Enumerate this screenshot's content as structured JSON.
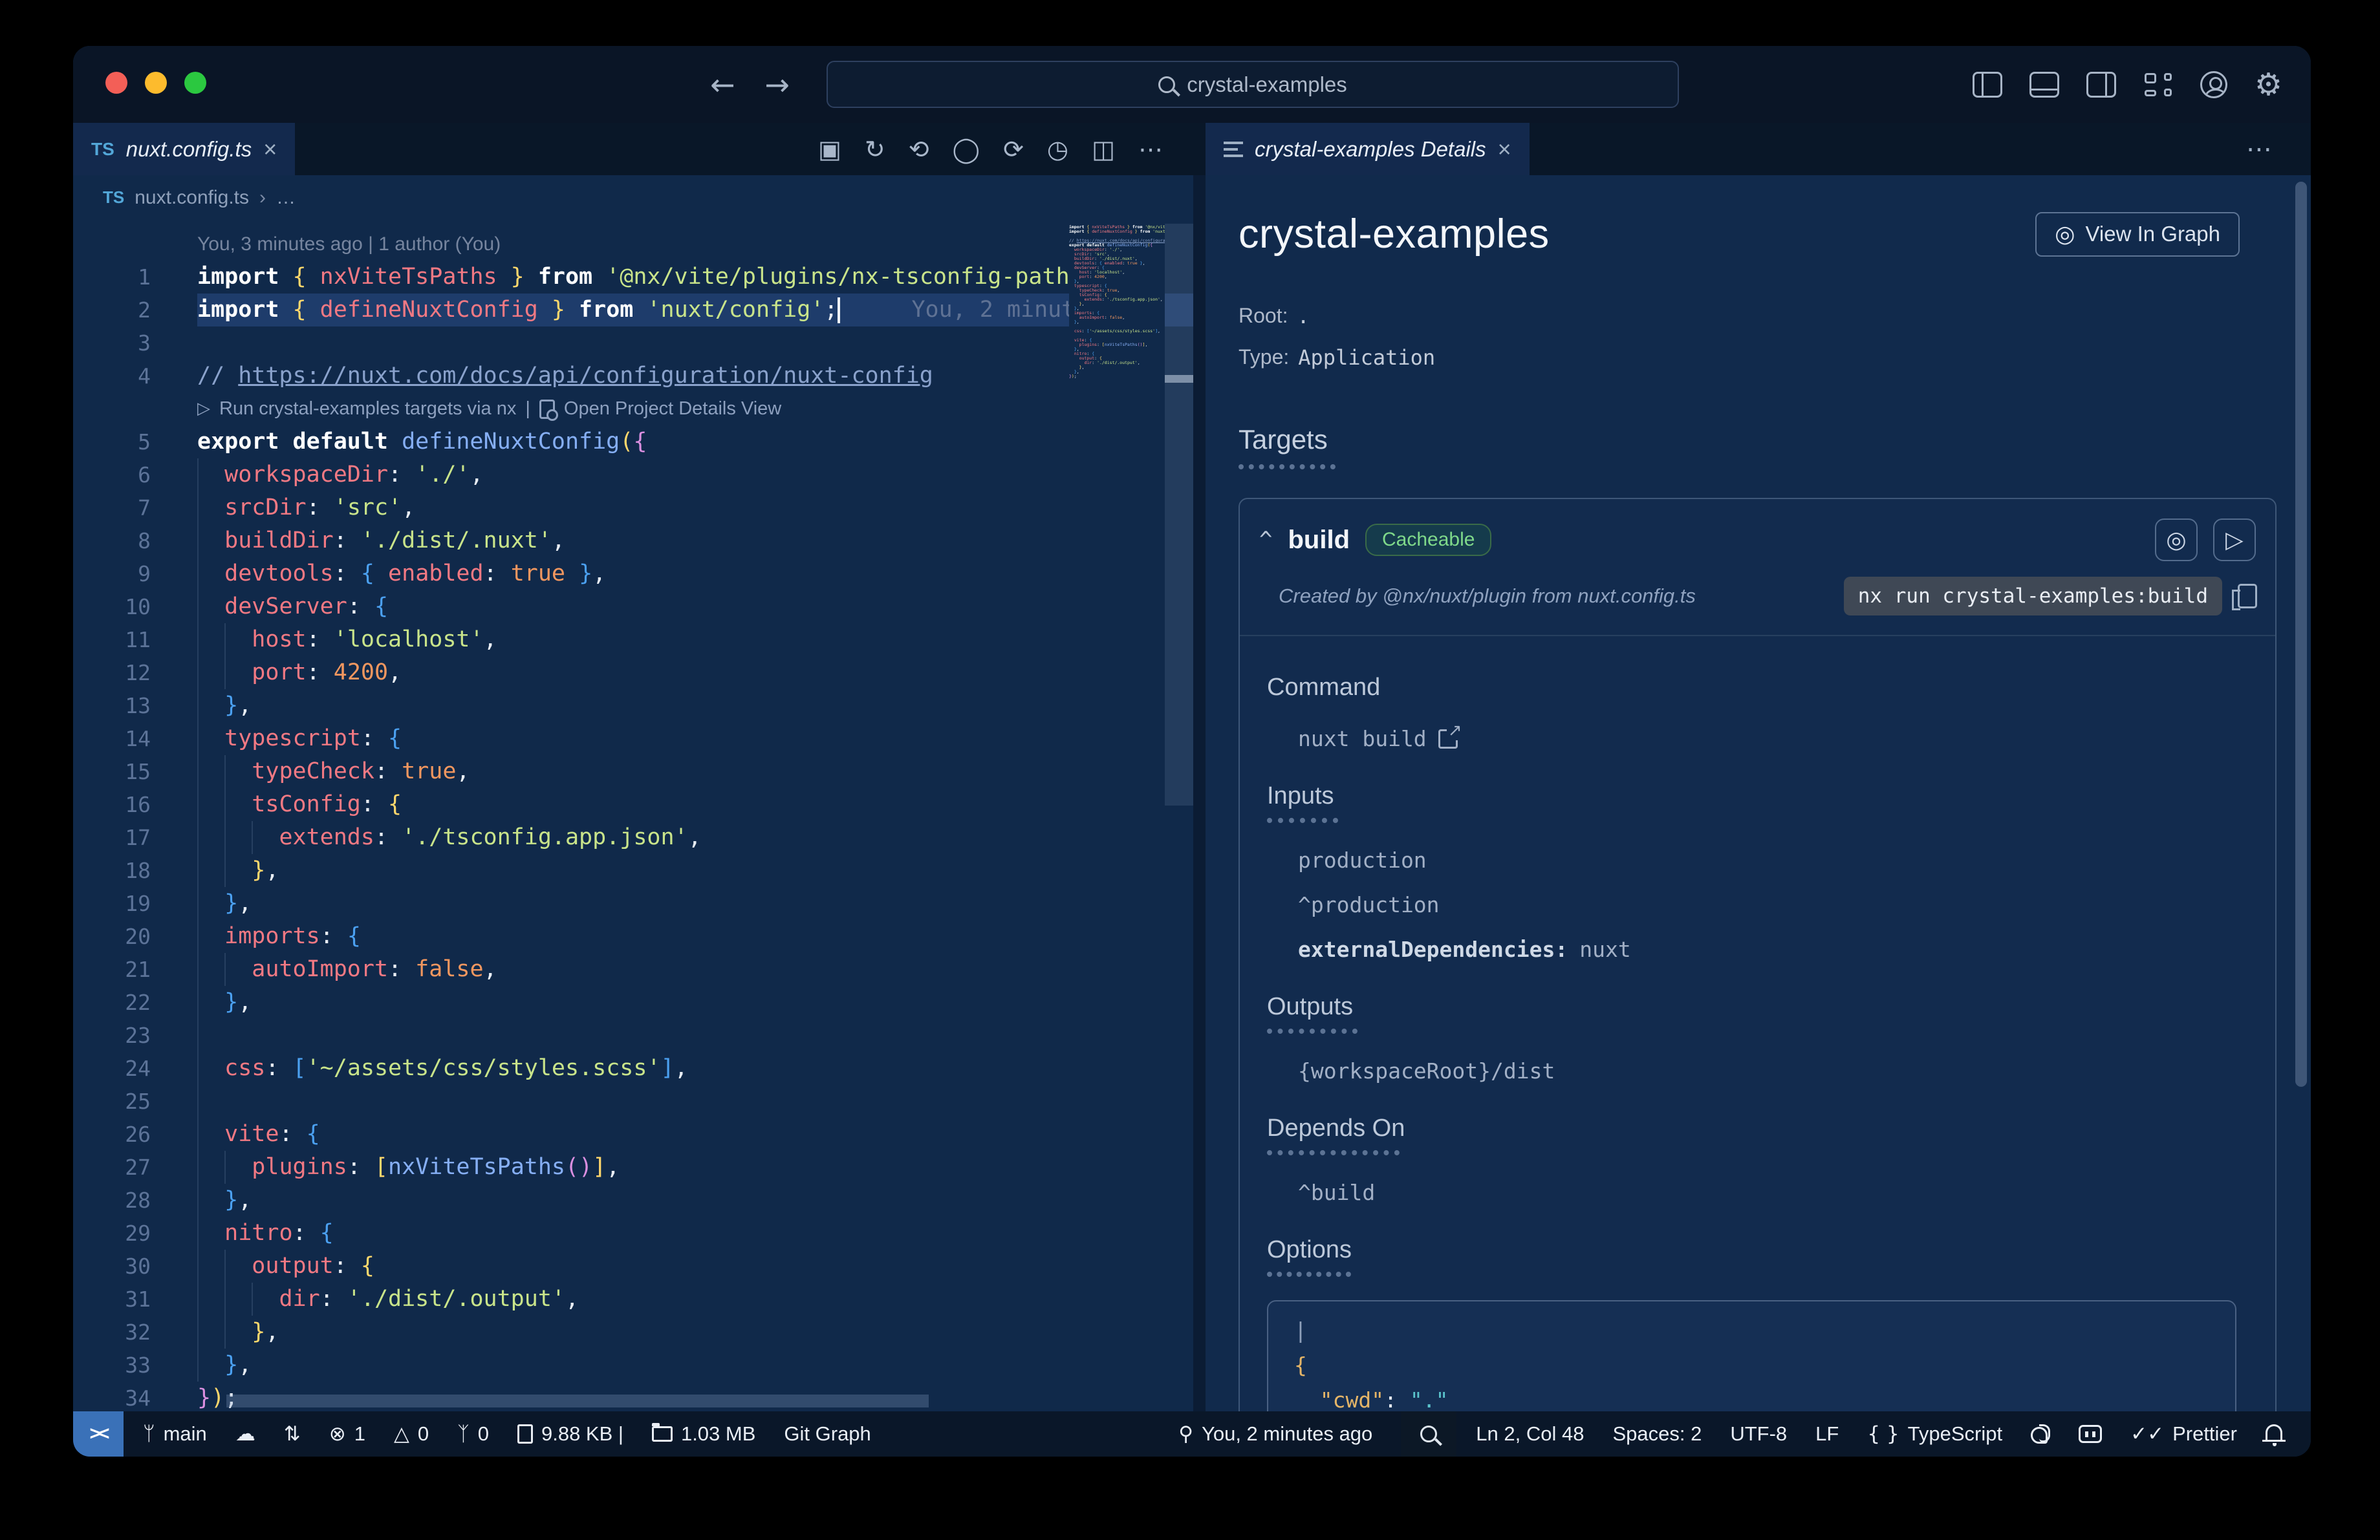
{
  "window": {
    "search_value": "crystal-examples",
    "titlebar_icons": [
      "toggle-panel-left",
      "toggle-panel-bottom",
      "toggle-panel-right",
      "customize-layout",
      "account",
      "settings-gear"
    ]
  },
  "editor": {
    "tab": {
      "file_type": "TS",
      "label": "nuxt.config.ts"
    },
    "toolbar_icons": [
      "open-changes",
      "refresh",
      "prev-change",
      "current-change",
      "next-change",
      "timeline",
      "split-editor",
      "more-actions"
    ],
    "breadcrumb": {
      "file_type": "TS",
      "file": "nuxt.config.ts",
      "separator": "›",
      "symbol": "…"
    },
    "blame_line": "You, 3 minutes ago | 1 author (You)",
    "inline_blame": "You, 2 minut",
    "codelens": {
      "run_label": "Run crystal-examples targets via nx",
      "separator": "|",
      "details_label": "Open Project Details View"
    },
    "lines": [
      {
        "t": "meta"
      },
      {
        "t": "c",
        "n": "1",
        "tok": [
          [
            "k",
            "import "
          ],
          [
            "by",
            "{ "
          ],
          [
            "prop",
            "nxViteTsPaths"
          ],
          [
            "by",
            " }"
          ],
          [
            "k",
            " from "
          ],
          [
            "str",
            "'@nx/vite/plugins/nx-tsconfig-paths"
          ]
        ]
      },
      {
        "t": "c",
        "n": "2",
        "cur": true,
        "tok": [
          [
            "k",
            "import "
          ],
          [
            "by",
            "{ "
          ],
          [
            "prop",
            "defineNuxtConfig"
          ],
          [
            "by",
            " }"
          ],
          [
            "k",
            " from "
          ],
          [
            "str",
            "'nuxt/config'"
          ],
          [
            "p",
            ";"
          ]
        ]
      },
      {
        "t": "c",
        "n": "3",
        "tok": []
      },
      {
        "t": "c",
        "n": "4",
        "tok": [
          [
            "com",
            "// "
          ],
          [
            "link",
            "https://nuxt.com/docs/api/configuration/nuxt-config"
          ]
        ]
      },
      {
        "t": "lens"
      },
      {
        "t": "c",
        "n": "5",
        "tok": [
          [
            "k",
            "export default "
          ],
          [
            "fn",
            "defineNuxtConfig"
          ],
          [
            "by",
            "("
          ],
          [
            "bm",
            "{"
          ]
        ]
      },
      {
        "t": "c",
        "n": "6",
        "tok": [
          [
            "p",
            "  "
          ],
          [
            "prop",
            "workspaceDir"
          ],
          [
            "p",
            ": "
          ],
          [
            "str",
            "'./'"
          ],
          [
            "p",
            ","
          ]
        ]
      },
      {
        "t": "c",
        "n": "7",
        "tok": [
          [
            "p",
            "  "
          ],
          [
            "prop",
            "srcDir"
          ],
          [
            "p",
            ": "
          ],
          [
            "str",
            "'src'"
          ],
          [
            "p",
            ","
          ]
        ]
      },
      {
        "t": "c",
        "n": "8",
        "tok": [
          [
            "p",
            "  "
          ],
          [
            "prop",
            "buildDir"
          ],
          [
            "p",
            ": "
          ],
          [
            "str",
            "'./dist/.nuxt'"
          ],
          [
            "p",
            ","
          ]
        ]
      },
      {
        "t": "c",
        "n": "9",
        "tok": [
          [
            "p",
            "  "
          ],
          [
            "prop",
            "devtools"
          ],
          [
            "p",
            ": "
          ],
          [
            "bb",
            "{ "
          ],
          [
            "prop",
            "enabled"
          ],
          [
            "p",
            ": "
          ],
          [
            "num",
            "true"
          ],
          [
            "bb",
            " }"
          ],
          [
            "p",
            ","
          ]
        ]
      },
      {
        "t": "c",
        "n": "10",
        "tok": [
          [
            "p",
            "  "
          ],
          [
            "prop",
            "devServer"
          ],
          [
            "p",
            ": "
          ],
          [
            "bb",
            "{"
          ]
        ]
      },
      {
        "t": "c",
        "n": "11",
        "tok": [
          [
            "p",
            "    "
          ],
          [
            "prop",
            "host"
          ],
          [
            "p",
            ": "
          ],
          [
            "str",
            "'localhost'"
          ],
          [
            "p",
            ","
          ]
        ]
      },
      {
        "t": "c",
        "n": "12",
        "tok": [
          [
            "p",
            "    "
          ],
          [
            "prop",
            "port"
          ],
          [
            "p",
            ": "
          ],
          [
            "num",
            "4200"
          ],
          [
            "p",
            ","
          ]
        ]
      },
      {
        "t": "c",
        "n": "13",
        "tok": [
          [
            "p",
            "  "
          ],
          [
            "bb",
            "}"
          ],
          [
            "p",
            ","
          ]
        ]
      },
      {
        "t": "c",
        "n": "14",
        "tok": [
          [
            "p",
            "  "
          ],
          [
            "prop",
            "typescript"
          ],
          [
            "p",
            ": "
          ],
          [
            "bb",
            "{"
          ]
        ]
      },
      {
        "t": "c",
        "n": "15",
        "tok": [
          [
            "p",
            "    "
          ],
          [
            "prop",
            "typeCheck"
          ],
          [
            "p",
            ": "
          ],
          [
            "num",
            "true"
          ],
          [
            "p",
            ","
          ]
        ]
      },
      {
        "t": "c",
        "n": "16",
        "tok": [
          [
            "p",
            "    "
          ],
          [
            "prop",
            "tsConfig"
          ],
          [
            "p",
            ": "
          ],
          [
            "by",
            "{"
          ]
        ]
      },
      {
        "t": "c",
        "n": "17",
        "tok": [
          [
            "p",
            "      "
          ],
          [
            "prop",
            "extends"
          ],
          [
            "p",
            ": "
          ],
          [
            "str",
            "'./tsconfig.app.json'"
          ],
          [
            "p",
            ","
          ]
        ]
      },
      {
        "t": "c",
        "n": "18",
        "tok": [
          [
            "p",
            "    "
          ],
          [
            "by",
            "}"
          ],
          [
            "p",
            ","
          ]
        ]
      },
      {
        "t": "c",
        "n": "19",
        "tok": [
          [
            "p",
            "  "
          ],
          [
            "bb",
            "}"
          ],
          [
            "p",
            ","
          ]
        ]
      },
      {
        "t": "c",
        "n": "20",
        "tok": [
          [
            "p",
            "  "
          ],
          [
            "prop",
            "imports"
          ],
          [
            "p",
            ": "
          ],
          [
            "bb",
            "{"
          ]
        ]
      },
      {
        "t": "c",
        "n": "21",
        "tok": [
          [
            "p",
            "    "
          ],
          [
            "prop",
            "autoImport"
          ],
          [
            "p",
            ": "
          ],
          [
            "num",
            "false"
          ],
          [
            "p",
            ","
          ]
        ]
      },
      {
        "t": "c",
        "n": "22",
        "tok": [
          [
            "p",
            "  "
          ],
          [
            "bb",
            "}"
          ],
          [
            "p",
            ","
          ]
        ]
      },
      {
        "t": "c",
        "n": "23",
        "g": 1,
        "tok": []
      },
      {
        "t": "c",
        "n": "24",
        "tok": [
          [
            "p",
            "  "
          ],
          [
            "prop",
            "css"
          ],
          [
            "p",
            ": "
          ],
          [
            "bb",
            "["
          ],
          [
            "str",
            "'~/assets/css/styles.scss'"
          ],
          [
            "bb",
            "]"
          ],
          [
            "p",
            ","
          ]
        ]
      },
      {
        "t": "c",
        "n": "25",
        "g": 1,
        "tok": []
      },
      {
        "t": "c",
        "n": "26",
        "tok": [
          [
            "p",
            "  "
          ],
          [
            "prop",
            "vite"
          ],
          [
            "p",
            ": "
          ],
          [
            "bb",
            "{"
          ]
        ]
      },
      {
        "t": "c",
        "n": "27",
        "tok": [
          [
            "p",
            "    "
          ],
          [
            "prop",
            "plugins"
          ],
          [
            "p",
            ": "
          ],
          [
            "by",
            "["
          ],
          [
            "fn",
            "nxViteTsPaths"
          ],
          [
            "bm",
            "()"
          ],
          [
            "by",
            "]"
          ],
          [
            "p",
            ","
          ]
        ]
      },
      {
        "t": "c",
        "n": "28",
        "tok": [
          [
            "p",
            "  "
          ],
          [
            "bb",
            "}"
          ],
          [
            "p",
            ","
          ]
        ]
      },
      {
        "t": "c",
        "n": "29",
        "tok": [
          [
            "p",
            "  "
          ],
          [
            "prop",
            "nitro"
          ],
          [
            "p",
            ": "
          ],
          [
            "bb",
            "{"
          ]
        ]
      },
      {
        "t": "c",
        "n": "30",
        "tok": [
          [
            "p",
            "    "
          ],
          [
            "prop",
            "output"
          ],
          [
            "p",
            ": "
          ],
          [
            "by",
            "{"
          ]
        ]
      },
      {
        "t": "c",
        "n": "31",
        "tok": [
          [
            "p",
            "      "
          ],
          [
            "prop",
            "dir"
          ],
          [
            "p",
            ": "
          ],
          [
            "str",
            "'./dist/.output'"
          ],
          [
            "p",
            ","
          ]
        ]
      },
      {
        "t": "c",
        "n": "32",
        "tok": [
          [
            "p",
            "    "
          ],
          [
            "by",
            "}"
          ],
          [
            "p",
            ","
          ]
        ]
      },
      {
        "t": "c",
        "n": "33",
        "tok": [
          [
            "p",
            "  "
          ],
          [
            "bb",
            "}"
          ],
          [
            "p",
            ","
          ]
        ]
      },
      {
        "t": "c",
        "n": "34",
        "tok": [
          [
            "bm",
            "}"
          ],
          [
            "by",
            ")"
          ],
          [
            "p",
            ";"
          ]
        ]
      }
    ]
  },
  "panel": {
    "tab_label": "crystal-examples Details",
    "title": "crystal-examples",
    "view_in_graph": "View In Graph",
    "root_label": "Root:",
    "root_value": ".",
    "type_label": "Type:",
    "type_value": "Application",
    "targets_heading": "Targets",
    "build": {
      "name": "build",
      "badge": "Cacheable",
      "created": "Created by @nx/nuxt/plugin from nuxt.config.ts",
      "command_chip": "nx run crystal-examples:build",
      "sections": [
        {
          "heading": "Command",
          "dotted": false,
          "dots_w": 0,
          "items": [
            {
              "text": "nuxt build",
              "external": true
            }
          ]
        },
        {
          "heading": "Inputs",
          "dotted": true,
          "dots_w": 110,
          "items": [
            {
              "text": "production"
            },
            {
              "text": "^production"
            },
            {
              "bold": "externalDependencies:",
              "text": " nuxt"
            }
          ]
        },
        {
          "heading": "Outputs",
          "dotted": true,
          "dots_w": 140,
          "items": [
            {
              "text": "{workspaceRoot}/dist"
            }
          ]
        },
        {
          "heading": "Depends On",
          "dotted": true,
          "dots_w": 205,
          "items": [
            {
              "text": "^build"
            }
          ]
        },
        {
          "heading": "Options",
          "dotted": true,
          "dots_w": 130,
          "items": [],
          "code": [
            [
              [
                "pipe",
                "|"
              ]
            ],
            [
              [
                "by",
                "{"
              ]
            ],
            [
              [
                "p",
                "  "
              ],
              [
                "key",
                "\"cwd\""
              ],
              [
                "p",
                ": "
              ],
              [
                "val",
                "\".\""
              ]
            ],
            [
              [
                "by",
                "}"
              ]
            ],
            [
              [
                "pipe",
                "|"
              ]
            ]
          ]
        }
      ]
    },
    "targets_dots_w": 150
  },
  "statusbar": {
    "left": [
      {
        "icon": "remote-indicator",
        "chip": "remote"
      },
      {
        "icon": "git-branch",
        "text": "main"
      },
      {
        "icon": "cloud-upload"
      },
      {
        "icon": "git-compare"
      },
      {
        "icon": "error-circle",
        "text": "1"
      },
      {
        "icon": "warning-triangle",
        "text": "0"
      },
      {
        "icon": "broadcast-tower",
        "text": "0"
      },
      {
        "icon": "file",
        "text": "9.88 KB |"
      },
      {
        "icon": "folder",
        "text": "1.03 MB"
      },
      {
        "text": "Git Graph"
      }
    ],
    "right": [
      {
        "icon": "blame-pin",
        "text": "You, 2 minutes ago",
        "push": true
      },
      {
        "icon": "zoom-magnifier",
        "chip": "zoom"
      },
      {
        "text": "Ln 2, Col 48"
      },
      {
        "text": "Spaces: 2"
      },
      {
        "text": "UTF-8"
      },
      {
        "text": "LF"
      },
      {
        "icon": "braces",
        "text": "TypeScript"
      },
      {
        "icon": "squirrel"
      },
      {
        "icon": "robot"
      },
      {
        "icon": "double-check",
        "text": "Prettier"
      },
      {
        "icon": "bell"
      }
    ]
  }
}
